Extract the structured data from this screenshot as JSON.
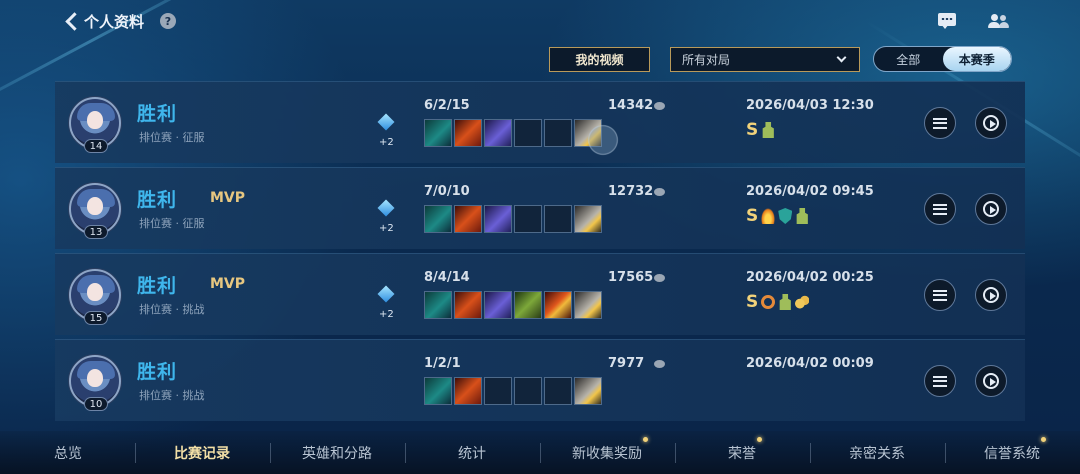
{
  "header": {
    "title": "个人资料",
    "help_symbol": "?",
    "icons": [
      "chat-icon",
      "friends-icon"
    ]
  },
  "filters": {
    "video_button": "我的视频",
    "match_filter_value": "所有对局",
    "season_options": [
      "全部",
      "本赛季"
    ],
    "season_selected": "本赛季"
  },
  "matches": [
    {
      "level": "14",
      "result": "胜利",
      "mvp": "",
      "mode": "排位赛 · 征服",
      "gem_bonus": "+2",
      "kda": "6/2/15",
      "score": "14342",
      "items": [
        "t-cyan",
        "t-fire",
        "t-violet",
        "t-empty",
        "t-empty",
        "t-gold"
      ],
      "datetime": "2026/04/03 12:30",
      "rating": "S",
      "badges": [
        "b-tower"
      ]
    },
    {
      "level": "13",
      "result": "胜利",
      "mvp": "MVP",
      "mode": "排位赛 · 征服",
      "gem_bonus": "+2",
      "kda": "7/0/10",
      "score": "12732",
      "items": [
        "t-cyan",
        "t-fire",
        "t-violet",
        "t-empty",
        "t-empty",
        "t-gold"
      ],
      "datetime": "2026/04/02 09:45",
      "rating": "S",
      "badges": [
        "b-flame",
        "b-shield",
        "b-tower"
      ]
    },
    {
      "level": "15",
      "result": "胜利",
      "mvp": "MVP",
      "mode": "排位赛 · 挑战",
      "gem_bonus": "+2",
      "kda": "8/4/14",
      "score": "17565",
      "items": [
        "t-cyan",
        "t-fire",
        "t-violet",
        "t-green",
        "t-red",
        "t-gold"
      ],
      "datetime": "2026/04/02 00:25",
      "rating": "S",
      "badges": [
        "b-ring",
        "b-tower",
        "b-coins"
      ]
    },
    {
      "level": "10",
      "result": "胜利",
      "mvp": "",
      "mode": "排位赛 · 挑战",
      "gem_bonus": "",
      "kda": "1/2/1",
      "score": "7977",
      "items": [
        "t-cyan",
        "t-fire",
        "t-empty",
        "t-empty",
        "t-empty",
        "t-gold"
      ],
      "datetime": "2026/04/02 00:09",
      "rating": "",
      "badges": []
    }
  ],
  "tabs": [
    {
      "label": "总览",
      "active": false,
      "dot": false
    },
    {
      "label": "比赛记录",
      "active": true,
      "dot": false
    },
    {
      "label": "英雄和分路",
      "active": false,
      "dot": false
    },
    {
      "label": "统计",
      "active": false,
      "dot": false
    },
    {
      "label": "新收集奖励",
      "active": false,
      "dot": true
    },
    {
      "label": "荣誉",
      "active": false,
      "dot": true
    },
    {
      "label": "亲密关系",
      "active": false,
      "dot": false
    },
    {
      "label": "信誉系统",
      "active": false,
      "dot": true
    }
  ],
  "colors": {
    "win": "#3fb6ec",
    "mvp": "#e7c780",
    "accent_gold": "#b99a5a",
    "active_tab": "#f2dfa6"
  }
}
